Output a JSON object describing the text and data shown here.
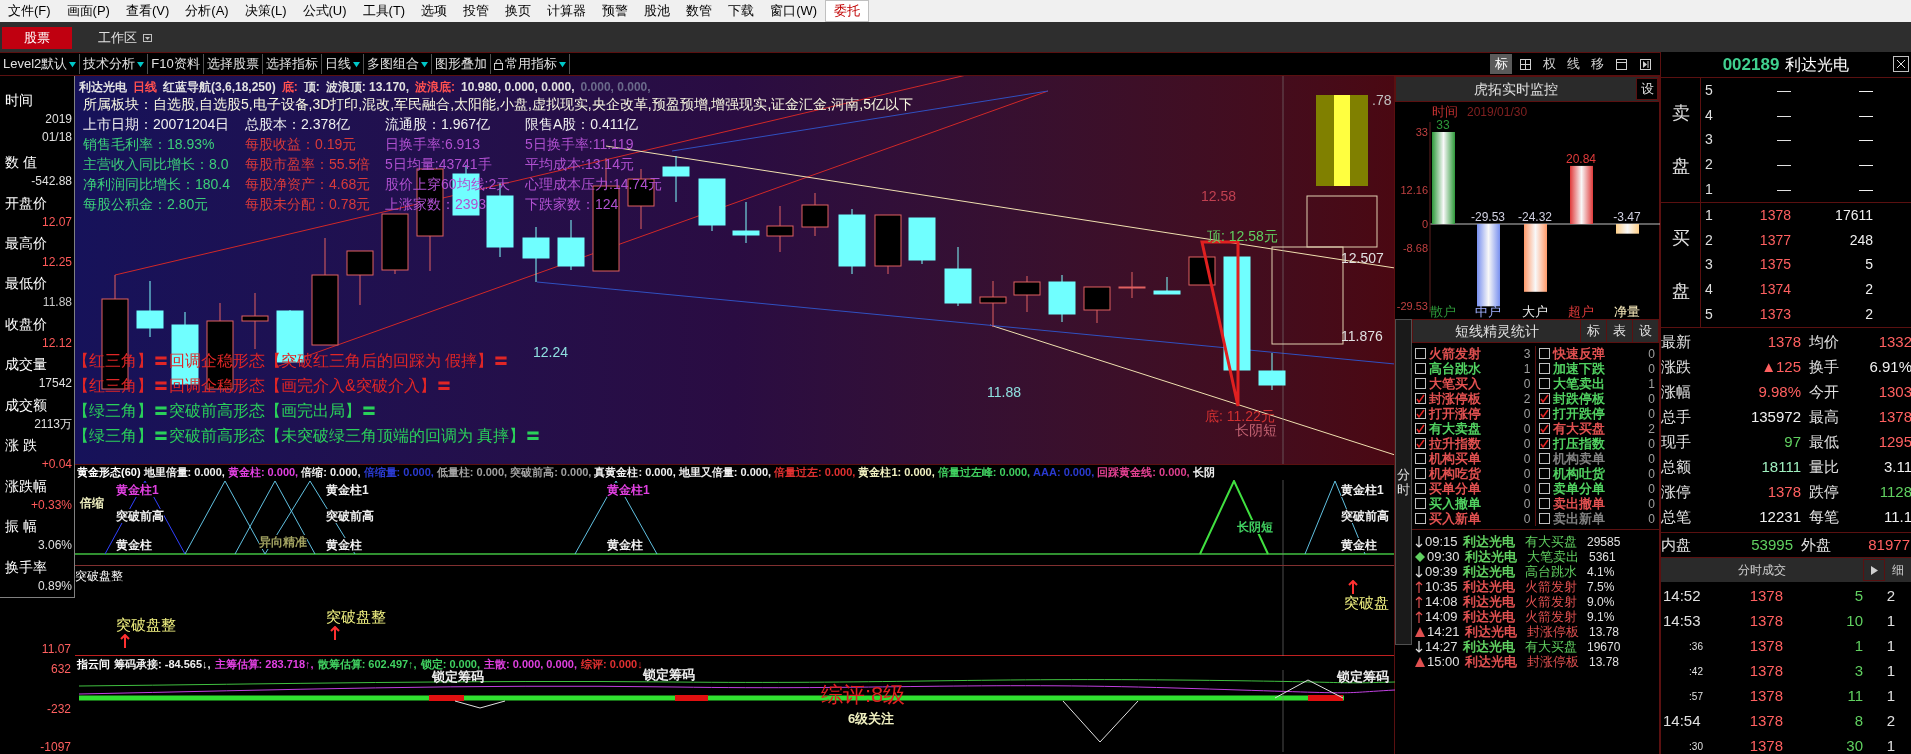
{
  "menu": [
    {
      "label": "文件(F)",
      "selected": false
    },
    {
      "label": "画面(P)",
      "selected": false
    },
    {
      "label": "查看(V)",
      "selected": false
    },
    {
      "label": "分析(A)",
      "selected": false
    },
    {
      "label": "决策(L)",
      "selected": false
    },
    {
      "label": "公式(U)",
      "selected": false
    },
    {
      "label": "工具(T)",
      "selected": false
    },
    {
      "label": "选项",
      "selected": false
    },
    {
      "label": "投管",
      "selected": false
    },
    {
      "label": "换页",
      "selected": false
    },
    {
      "label": "计算器",
      "selected": false
    },
    {
      "label": "预警",
      "selected": false
    },
    {
      "label": "股池",
      "selected": false
    },
    {
      "label": "数管",
      "selected": false
    },
    {
      "label": "下载",
      "selected": false
    },
    {
      "label": "窗口(W)",
      "selected": false
    },
    {
      "label": "委托",
      "selected": true
    }
  ],
  "tabs": [
    {
      "label": "股票",
      "selected": true
    },
    {
      "label": "工作区",
      "selected": false
    }
  ],
  "toolbar": [
    {
      "label": "Level2默认",
      "dropdown": true,
      "kind": "plain"
    },
    {
      "label": "技术分析",
      "dropdown": true,
      "kind": "plain"
    },
    {
      "label": "F10资料",
      "dropdown": false,
      "kind": "plain"
    },
    {
      "label": "选择股票",
      "dropdown": false,
      "kind": "plain"
    },
    {
      "label": "选择指标",
      "dropdown": false,
      "kind": "plain"
    },
    {
      "label": "日线",
      "dropdown": true,
      "kind": "plain"
    },
    {
      "label": "多图组合",
      "dropdown": true,
      "kind": "plain"
    },
    {
      "label": "图形叠加",
      "dropdown": false,
      "kind": "plain"
    },
    {
      "label": "常用指标",
      "dropdown": true,
      "kind": "lock"
    }
  ],
  "view_buttons": [
    {
      "kind": "text",
      "label": "标",
      "selected": true
    },
    {
      "kind": "grid",
      "selected": false
    },
    {
      "kind": "text",
      "label": "权",
      "selected": false
    },
    {
      "kind": "text",
      "label": "线",
      "selected": false
    },
    {
      "kind": "text",
      "label": "移",
      "selected": false
    },
    {
      "kind": "window",
      "selected": false
    },
    {
      "kind": "skip",
      "selected": false
    }
  ],
  "left_stats": [
    {
      "label": "时间",
      "values": [
        "2019",
        "01/18"
      ],
      "color": "#e0e0e0"
    },
    {
      "label": "数 值",
      "values": [
        "-542.88"
      ],
      "color": "#e0e0e0"
    },
    {
      "label": "开盘价",
      "values": [
        "12.07"
      ],
      "color": "#ff5a5a"
    },
    {
      "label": "最高价",
      "values": [
        "12.25"
      ],
      "color": "#ff5a5a"
    },
    {
      "label": "最低价",
      "values": [
        "11.88"
      ],
      "color": "#c8c8c8"
    },
    {
      "label": "收盘价",
      "values": [
        "12.12"
      ],
      "color": "#ff5a5a"
    },
    {
      "label": "成交量",
      "values": [
        "17542"
      ],
      "color": "#e0e0e0"
    },
    {
      "label": "成交额",
      "values": [
        "2113万"
      ],
      "color": "#e0e0e0"
    },
    {
      "label": "涨 跌",
      "values": [
        "+0.04"
      ],
      "color": "#ff5a5a"
    },
    {
      "label": "涨跌幅",
      "values": [
        "+0.33%"
      ],
      "color": "#ff5a5a"
    },
    {
      "label": "振 幅",
      "values": [
        "3.06%"
      ],
      "color": "#e0e0e0"
    },
    {
      "label": "换手率",
      "values": [
        "0.89%"
      ],
      "color": "#e0e0e0"
    }
  ],
  "left_axis": [
    "11.07",
    "632",
    "-232",
    "-1097"
  ],
  "chart_header": [
    {
      "text": "利达光电",
      "color": "#e0e0e0"
    },
    {
      "text": "日线",
      "color": "#ff5050"
    },
    {
      "text": "红蓝导航(3,6,18,250)",
      "color": "#e0e0e0"
    },
    {
      "text": "底:",
      "color": "#ff5050"
    },
    {
      "text": "顶:",
      "color": "#e0e0e0"
    },
    {
      "text": "波浪顶: 13.170,",
      "color": "#e0e0e0"
    },
    {
      "text": "波浪底:",
      "color": "#ff5050"
    },
    {
      "text": "10.980, 0.000, 0.000,",
      "color": "#e0e0e0"
    },
    {
      "text": "0.000, 0.000,",
      "color": "#6a6a8a"
    }
  ],
  "info_sectors": "所属板块：自选股,自选股5,电子设备,3D打印,混改,军民融合,太阳能,小盘,虚拟现实,央企改革,预盈预增,增强现实,证金汇金,河南,5亿以下",
  "info_rows": [
    [
      {
        "text": "上市日期：20071204日",
        "color": "#f0f0f0"
      },
      {
        "text": "总股本：2.378亿",
        "color": "#f0f0f0"
      },
      {
        "text": "流通股：1.967亿",
        "color": "#f0f0f0"
      },
      {
        "text": "限售A股：0.411亿",
        "color": "#f0f0f0"
      }
    ],
    [
      {
        "text": "销售毛利率：18.93%",
        "color": "#3ccf7a"
      },
      {
        "text": "每股收益：0.19元",
        "color": "#d83a3a"
      },
      {
        "text": "日换手率:6.913",
        "color": "#b050d0"
      },
      {
        "text": "5日换手率:11.119",
        "color": "#b050d0"
      }
    ],
    [
      {
        "text": "主营收入同比增长：8.0",
        "color": "#3ccf7a"
      },
      {
        "text": "每股市盈率：55.5倍",
        "color": "#d83a3a"
      },
      {
        "text": "5日均量:43741手",
        "color": "#b050d0"
      },
      {
        "text": "平均成本:13.14元",
        "color": "#b050d0"
      }
    ],
    [
      {
        "text": "净利润同比增长：180.4",
        "color": "#3ccf7a"
      },
      {
        "text": "每股净资产：4.68元",
        "color": "#d83a3a"
      },
      {
        "text": "股价上穿60均线:2天",
        "color": "#b050d0"
      },
      {
        "text": "心理成本压力:14.74元",
        "color": "#b050d0"
      }
    ],
    [
      {
        "text": "每股公积金：2.80元",
        "color": "#3ccf7a"
      },
      {
        "text": "每股未分配：0.78元",
        "color": "#d83a3a"
      },
      {
        "text": "上涨家数：2393",
        "color": "#b050d0"
      },
      {
        "text": "下跌家数：124",
        "color": "#b050d0"
      }
    ]
  ],
  "chart_labels": [
    {
      "text": "12.24",
      "color": "#8fe0e0"
    },
    {
      "text": "11.88",
      "color": "#8fe0e0"
    },
    {
      "text": "12.58",
      "color": "#c04050"
    },
    {
      "text": "顶: 12.58元",
      "color": "#60d060"
    },
    {
      "text": "12.507",
      "color": "#e0e0e0"
    },
    {
      "text": "11.876",
      "color": "#e0e0e0"
    },
    {
      "text": "底: 11.22元",
      "color": "#d03030"
    },
    {
      "text": "长阴短",
      "color": "#c06070"
    },
    {
      "text": ".78",
      "color": "#c0c0c0"
    }
  ],
  "signals": [
    {
      "text": "【红三角】〓回调企稳形态【突破红三角后的回踩为 假摔】〓",
      "color": "#e02626"
    },
    {
      "text": "【红三角】〓回调企稳形态【画完介入&突破介入】〓",
      "color": "#e02626"
    },
    {
      "text": "【绿三角】〓突破前高形态【画完出局】〓",
      "color": "#2ad05a"
    },
    {
      "text": "【绿三角】〓突破前高形态【未突破绿三角顶端的回调为 真摔】〓",
      "color": "#2ad05a"
    }
  ],
  "indicator_1": {
    "title": "黄金形态(60)",
    "items": [
      {
        "text": "地里倍量: 0.000,",
        "color": "#f0f0f0"
      },
      {
        "text": "黄金柱: 0.000,",
        "color": "#e040e0"
      },
      {
        "text": "倍缩: 0.000,",
        "color": "#f0f0f0"
      },
      {
        "text": "倍缩量: 0.000,",
        "color": "#2a3ad0"
      },
      {
        "text": "低量柱: 0.000,",
        "color": "#a0a0a0"
      },
      {
        "text": "突破前高: 0.000,",
        "color": "#a0a0a0"
      },
      {
        "text": "真黄金柱: 0.000,",
        "color": "#f0f0f0"
      },
      {
        "text": "地里又倍量: 0.000,",
        "color": "#f0f0f0"
      },
      {
        "text": "倍量过左: 0.000,",
        "color": "#e03030"
      },
      {
        "text": "黄金柱1: 0.000,",
        "color": "#f0f0c0"
      },
      {
        "text": "倍量过左峰: 0.000,",
        "color": "#40d060"
      },
      {
        "text": "AAA: 0.000,",
        "color": "#2a3ad0"
      },
      {
        "text": "回踩黄金线: 0.000,",
        "color": "#e04090"
      },
      {
        "text": "长阴",
        "color": "#f0f0f0"
      }
    ],
    "labels": [
      {
        "text": "倍缩",
        "color": "#f0f0c0"
      },
      {
        "text": "黄金柱1",
        "color": "#e040e0"
      },
      {
        "text": "突破前高",
        "color": "#f0f0f0"
      },
      {
        "text": "黄金柱",
        "color": "#f0f0f0"
      },
      {
        "text": "异向精准",
        "color": "#a0a060"
      },
      {
        "text": "黄金柱1",
        "color": "#f0f0f0"
      },
      {
        "text": "突破前高",
        "color": "#f0f0f0"
      },
      {
        "text": "黄金柱",
        "color": "#f0f0f0"
      },
      {
        "text": "黄金柱1",
        "color": "#e040e0"
      },
      {
        "text": "黄金柱",
        "color": "#f0f0f0"
      },
      {
        "text": "长阴短",
        "color": "#40d060"
      },
      {
        "text": "黄金柱1",
        "color": "#f0f0f0"
      },
      {
        "text": "突破前高",
        "color": "#f0f0f0"
      },
      {
        "text": "黄金柱",
        "color": "#f0f0f0"
      }
    ]
  },
  "indicator_2": {
    "title": "突破盘整",
    "labels": [
      "突破盘整",
      "突破盘整",
      "突破盘"
    ]
  },
  "indicator_3": {
    "title": "指云间",
    "items": [
      {
        "text": "筹码承接: -84.565↓,",
        "color": "#f0f0f0"
      },
      {
        "text": "主筹估算: 283.718↑,",
        "color": "#e040e0"
      },
      {
        "text": "散筹估算: 602.497↑,",
        "color": "#40d060"
      },
      {
        "text": "锁定: 0.000,",
        "color": "#40d060"
      },
      {
        "text": "主散: 0.000, 0.000,",
        "color": "#e040e0"
      },
      {
        "text": "综评: 0.000↓",
        "color": "#e03030"
      }
    ],
    "labels": [
      {
        "text": "锁定筹码",
        "color": "#f0f0f0"
      },
      {
        "text": "锁定筹码",
        "color": "#f0f0f0"
      },
      {
        "text": "综评:8级",
        "color": "#e02020"
      },
      {
        "text": "6级关注",
        "color": "#f0f0c0"
      },
      {
        "text": "锁定筹码",
        "color": "#f0f0f0"
      }
    ]
  },
  "monitor": {
    "title": "虎拓实时监控",
    "settings": "设",
    "time_label": "时间",
    "date": "2019/01/30",
    "chart_data": {
      "type": "bar",
      "categories": [
        "散户",
        "中户",
        "大户",
        "超户",
        "净量"
      ],
      "series": [
        {
          "values": [
            33,
            -29.53,
            -24.32,
            20.84,
            -3.47
          ]
        }
      ],
      "ylim": [
        -29.53,
        33
      ],
      "yticks": [
        {
          "value": 33,
          "label": "33"
        },
        {
          "value": 12.16,
          "label": "12.16"
        },
        {
          "value": 0,
          "label": "0"
        },
        {
          "value": -8.68,
          "label": "-8.68"
        },
        {
          "value": -29.53,
          "label": "-29.53"
        }
      ],
      "data_labels": true,
      "value_labels": [
        "33",
        "-29.53",
        "-24.32",
        "20.84",
        "-3.47"
      ]
    }
  },
  "sprite": {
    "title": "短线精灵统计",
    "buttons": [
      "标",
      "表",
      "设"
    ],
    "side_tab": "分时",
    "left": [
      {
        "label": "火箭发射",
        "count": "3",
        "checked": false,
        "color": "#e05050"
      },
      {
        "label": "高台跳水",
        "count": "1",
        "checked": false,
        "color": "#50d060"
      },
      {
        "label": "大笔买入",
        "count": "0",
        "checked": false,
        "color": "#e05050"
      },
      {
        "label": "封涨停板",
        "count": "2",
        "checked": true,
        "color": "#e05050"
      },
      {
        "label": "打开涨停",
        "count": "0",
        "checked": true,
        "color": "#e05050"
      },
      {
        "label": "有大卖盘",
        "count": "0",
        "checked": true,
        "color": "#50d060"
      },
      {
        "label": "拉升指数",
        "count": "0",
        "checked": true,
        "color": "#e05050"
      },
      {
        "label": "机构买单",
        "count": "0",
        "checked": false,
        "color": "#e05050"
      },
      {
        "label": "机构吃货",
        "count": "0",
        "checked": false,
        "color": "#e05050"
      },
      {
        "label": "买单分单",
        "count": "0",
        "checked": false,
        "color": "#e05050"
      },
      {
        "label": "买入撤单",
        "count": "0",
        "checked": false,
        "color": "#50d060"
      },
      {
        "label": "买入新单",
        "count": "0",
        "checked": false,
        "color": "#e05050"
      }
    ],
    "right": [
      {
        "label": "快速反弹",
        "count": "0",
        "checked": false,
        "color": "#e05050"
      },
      {
        "label": "加速下跌",
        "count": "0",
        "checked": false,
        "color": "#50d060"
      },
      {
        "label": "大笔卖出",
        "count": "1",
        "checked": false,
        "color": "#50d060"
      },
      {
        "label": "封跌停板",
        "count": "0",
        "checked": true,
        "color": "#50d060"
      },
      {
        "label": "打开跌停",
        "count": "0",
        "checked": true,
        "color": "#50d060"
      },
      {
        "label": "有大买盘",
        "count": "2",
        "checked": true,
        "color": "#e05050"
      },
      {
        "label": "打压指数",
        "count": "0",
        "checked": true,
        "color": "#50d060"
      },
      {
        "label": "机构卖单",
        "count": "0",
        "checked": false,
        "color": "#808080"
      },
      {
        "label": "机构吐货",
        "count": "0",
        "checked": false,
        "color": "#50d060"
      },
      {
        "label": "卖单分单",
        "count": "0",
        "checked": false,
        "color": "#50d060"
      },
      {
        "label": "卖出撤单",
        "count": "0",
        "checked": false,
        "color": "#e05050"
      },
      {
        "label": "卖出新单",
        "count": "0",
        "checked": false,
        "color": "#808080"
      }
    ],
    "events": [
      {
        "kind": "down",
        "time": "09:15",
        "name": "利达光电",
        "event": "有大买盘",
        "value": "29585",
        "color": "#60d060"
      },
      {
        "kind": "diamond",
        "time": "09:30",
        "name": "利达光电",
        "event": "大笔卖出",
        "value": "5361",
        "color": "#60d060"
      },
      {
        "kind": "down",
        "time": "09:39",
        "name": "利达光电",
        "event": "高台跳水",
        "value": "4.1%",
        "color": "#60d060"
      },
      {
        "kind": "up",
        "time": "10:35",
        "name": "利达光电",
        "event": "火箭发射",
        "value": "7.5%",
        "color": "#e05050"
      },
      {
        "kind": "up",
        "time": "14:08",
        "name": "利达光电",
        "event": "火箭发射",
        "value": "9.0%",
        "color": "#e05050"
      },
      {
        "kind": "up",
        "time": "14:09",
        "name": "利达光电",
        "event": "火箭发射",
        "value": "9.1%",
        "color": "#e05050"
      },
      {
        "kind": "triangle",
        "time": "14:21",
        "name": "利达光电",
        "event": "封涨停板",
        "value": "13.78",
        "color": "#e05050"
      },
      {
        "kind": "down",
        "time": "14:27",
        "name": "利达光电",
        "event": "有大买盘",
        "value": "19670",
        "color": "#60d060"
      },
      {
        "kind": "triangle",
        "time": "15:00",
        "name": "利达光电",
        "event": "封涨停板",
        "value": "13.78",
        "color": "#e05050"
      }
    ]
  },
  "quote": {
    "code": "002189",
    "name": "利达光电",
    "sell_label": [
      "卖",
      "盘"
    ],
    "buy_label": [
      "买",
      "盘"
    ],
    "sell": [
      {
        "level": "5",
        "price": "—",
        "volume": "—"
      },
      {
        "level": "4",
        "price": "—",
        "volume": "—"
      },
      {
        "level": "3",
        "price": "—",
        "volume": "—"
      },
      {
        "level": "2",
        "price": "—",
        "volume": "—"
      },
      {
        "level": "1",
        "price": "—",
        "volume": "—"
      }
    ],
    "buy": [
      {
        "level": "1",
        "price": "1378",
        "volume": "17611"
      },
      {
        "level": "2",
        "price": "1377",
        "volume": "248"
      },
      {
        "level": "3",
        "price": "1375",
        "volume": "5"
      },
      {
        "level": "4",
        "price": "1374",
        "volume": "2"
      },
      {
        "level": "5",
        "price": "1373",
        "volume": "2"
      }
    ],
    "stats": [
      {
        "label": "最新",
        "value": "1378",
        "color": "#ff6060"
      },
      {
        "label": "均价",
        "value": "1332",
        "color": "#ff6060"
      },
      {
        "label": "涨跌",
        "value": "▲125",
        "color": "#ff6060"
      },
      {
        "label": "换手",
        "value": "6.91%",
        "color": "#f0f0f0"
      },
      {
        "label": "涨幅",
        "value": "9.98%",
        "color": "#ff6060"
      },
      {
        "label": "今开",
        "value": "1303",
        "color": "#ff6060"
      },
      {
        "label": "总手",
        "value": "135972",
        "color": "#f0f0f0"
      },
      {
        "label": "最高",
        "value": "1378",
        "color": "#ff6060"
      },
      {
        "label": "现手",
        "value": "97",
        "color": "#60d060"
      },
      {
        "label": "最低",
        "value": "1295",
        "color": "#ff6060"
      },
      {
        "label": "总额",
        "value": "18111",
        "color": "#a0f0c0"
      },
      {
        "label": "量比",
        "value": "3.11",
        "color": "#f0f0f0"
      },
      {
        "label": "涨停",
        "value": "1378",
        "color": "#ff6060"
      },
      {
        "label": "跌停",
        "value": "1128",
        "color": "#60d060"
      },
      {
        "label": "总笔",
        "value": "12231",
        "color": "#f0f0f0"
      },
      {
        "label": "每笔",
        "value": "11.1",
        "color": "#f0f0f0"
      }
    ],
    "inner": {
      "label": "内盘",
      "value": "53995",
      "label2": "外盘",
      "value2": "81977"
    },
    "trades_title": "分时成交",
    "trades_tab": "细",
    "trades": [
      {
        "time": "14:52",
        "price": "1378",
        "volume": "5",
        "count": "2"
      },
      {
        "time": "14:53",
        "price": "1378",
        "volume": "10",
        "count": "1"
      },
      {
        "time": ":36",
        "price": "1378",
        "volume": "1",
        "count": "1"
      },
      {
        "time": ":42",
        "price": "1378",
        "volume": "3",
        "count": "1"
      },
      {
        "time": ":57",
        "price": "1378",
        "volume": "11",
        "count": "1"
      },
      {
        "time": "14:54",
        "price": "1378",
        "volume": "8",
        "count": "2"
      },
      {
        "time": ":30",
        "price": "1378",
        "volume": "30",
        "count": "1"
      }
    ]
  }
}
